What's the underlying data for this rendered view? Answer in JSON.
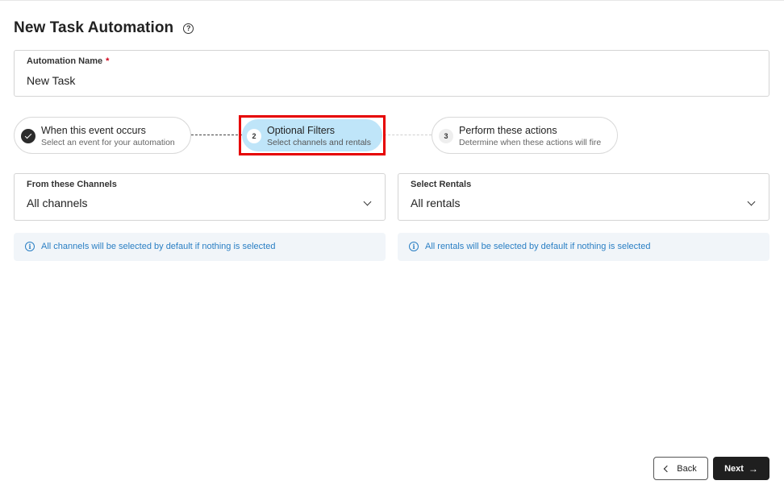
{
  "page": {
    "title": "New Task Automation",
    "help_icon": "?"
  },
  "automation_name": {
    "label": "Automation Name",
    "required_marker": "*",
    "value": "New Task"
  },
  "steps": [
    {
      "number": "1",
      "title": "When this event occurs",
      "subtitle": "Select an event for your automation",
      "status": "completed"
    },
    {
      "number": "2",
      "title": "Optional Filters",
      "subtitle": "Select channels and rentals",
      "status": "active"
    },
    {
      "number": "3",
      "title": "Perform these actions",
      "subtitle": "Determine when these actions will fire",
      "status": "pending"
    }
  ],
  "channels": {
    "label": "From these Channels",
    "value": "All channels",
    "info": "All channels will be selected by default if nothing is selected"
  },
  "rentals": {
    "label": "Select Rentals",
    "value": "All rentals",
    "info": "All rentals will be selected by default if nothing is selected"
  },
  "footer": {
    "back_label": "Back",
    "next_label": "Next",
    "next_arrow": "→"
  },
  "colors": {
    "active_step": "#bfe5f9",
    "info_text": "#2a7fc4",
    "info_bg": "#f1f5f9",
    "highlight": "#e60000",
    "primary_button": "#1f1f1f",
    "required": "#d0021b"
  }
}
